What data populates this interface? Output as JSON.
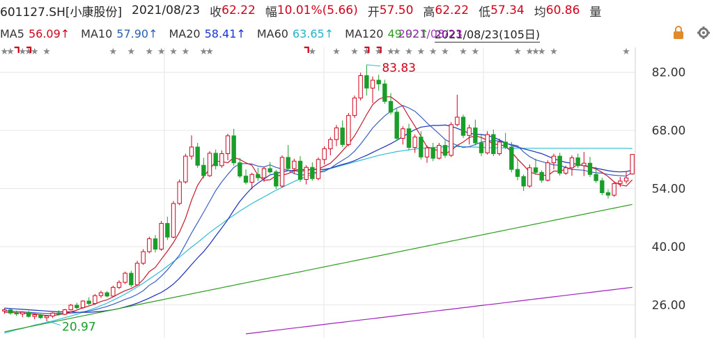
{
  "header": {
    "stock": "601127.SH[小康股份]",
    "date": "2021/08/23",
    "close_label": "收",
    "close": "62.22",
    "change_label": "幅",
    "change": "10.01%(5.66)",
    "open_label": "开",
    "open": "57.50",
    "high_label": "高",
    "high": "62.22",
    "low_label": "低",
    "low": "57.34",
    "avg_label": "均",
    "avg": "60.86",
    "vol_label": "量"
  },
  "ma_bar": {
    "items": [
      {
        "label": "MA5",
        "value": "56.09↑",
        "color": "#d0021b"
      },
      {
        "label": "MA10",
        "value": "57.90↑",
        "color": "#2a5fb0"
      },
      {
        "label": "MA20",
        "value": "58.41↑",
        "color": "#1a33d6"
      },
      {
        "label": "MA60",
        "value": "63.65↑",
        "color": "#22b3cc"
      },
      {
        "label": "MA120",
        "value": "49.92↑",
        "color": "#2e9e1f"
      }
    ],
    "overlap_text": "2021/08/23",
    "overlap_color": "#a020c0",
    "range_text": "2021/08/23(105日)"
  },
  "colors": {
    "up": "#d0021b",
    "down": "#1a9e2a",
    "ma5": "#c2182b",
    "ma10": "#3b5fc0",
    "ma20": "#1a2eb8",
    "ma60": "#2fbcd6",
    "ma120": "#2e9e1f",
    "ma250": "#a020c0",
    "grid": "#e6e6e6",
    "axis_text": "#333333"
  },
  "icons": [
    "lock-icon",
    "gear-icon"
  ],
  "chart_data": {
    "type": "candlestick",
    "ylim": [
      18,
      88
    ],
    "yticks": [
      "82.00",
      "68.00",
      "54.00",
      "40.00",
      "26.00"
    ],
    "annotations": [
      {
        "text": "83.83",
        "type": "max",
        "color": "#d0021b"
      },
      {
        "text": "20.97",
        "type": "min",
        "color": "#1a9e2a"
      }
    ],
    "candles": [
      [
        24.5,
        25.2,
        23.8,
        24.8
      ],
      [
        24.8,
        25.0,
        23.6,
        24.0
      ],
      [
        24.0,
        24.6,
        23.3,
        23.8
      ],
      [
        23.8,
        24.4,
        23.0,
        24.2
      ],
      [
        24.2,
        24.5,
        22.9,
        23.2
      ],
      [
        23.2,
        23.9,
        22.5,
        23.6
      ],
      [
        23.6,
        23.8,
        22.6,
        22.9
      ],
      [
        22.9,
        23.5,
        22.1,
        23.3
      ],
      [
        23.3,
        24.2,
        22.8,
        24.0
      ],
      [
        24.0,
        24.7,
        23.4,
        23.7
      ],
      [
        23.7,
        25.0,
        23.5,
        24.8
      ],
      [
        24.8,
        26.2,
        24.6,
        25.9
      ],
      [
        25.9,
        26.5,
        24.9,
        25.3
      ],
      [
        25.3,
        27.1,
        25.0,
        26.9
      ],
      [
        26.9,
        27.8,
        25.9,
        26.3
      ],
      [
        26.3,
        28.6,
        26.0,
        28.2
      ],
      [
        28.2,
        29.4,
        27.6,
        28.9
      ],
      [
        28.9,
        29.3,
        27.8,
        28.1
      ],
      [
        28.1,
        30.6,
        27.9,
        30.2
      ],
      [
        30.2,
        31.9,
        29.8,
        31.4
      ],
      [
        31.4,
        34.0,
        31.0,
        33.6
      ],
      [
        33.6,
        34.2,
        30.2,
        30.8
      ],
      [
        30.8,
        36.6,
        30.6,
        36.0
      ],
      [
        36.0,
        39.4,
        35.6,
        38.8
      ],
      [
        38.8,
        42.4,
        38.4,
        41.9
      ],
      [
        41.9,
        42.8,
        38.6,
        39.4
      ],
      [
        39.4,
        46.2,
        39.0,
        45.6
      ],
      [
        45.6,
        47.2,
        41.6,
        42.3
      ],
      [
        42.3,
        51.0,
        42.0,
        50.4
      ],
      [
        50.4,
        56.2,
        50.0,
        55.6
      ],
      [
        55.6,
        62.4,
        55.2,
        61.8
      ],
      [
        61.8,
        66.8,
        61.0,
        64.0
      ],
      [
        64.0,
        65.0,
        59.0,
        59.6
      ],
      [
        59.6,
        61.4,
        56.4,
        57.1
      ],
      [
        57.1,
        63.0,
        56.8,
        62.5
      ],
      [
        62.5,
        63.4,
        58.6,
        59.5
      ],
      [
        59.5,
        63.2,
        59.0,
        62.4
      ],
      [
        62.4,
        67.2,
        60.8,
        66.7
      ],
      [
        66.7,
        68.4,
        59.5,
        60.2
      ],
      [
        60.2,
        61.4,
        56.5,
        57.0
      ],
      [
        57.0,
        58.6,
        55.0,
        55.5
      ],
      [
        55.5,
        57.8,
        53.8,
        57.4
      ],
      [
        57.4,
        59.0,
        55.8,
        56.6
      ],
      [
        56.6,
        59.3,
        55.6,
        58.8
      ],
      [
        58.8,
        60.4,
        57.6,
        58.0
      ],
      [
        58.0,
        58.5,
        53.9,
        54.6
      ],
      [
        54.6,
        62.0,
        54.2,
        61.5
      ],
      [
        61.5,
        64.5,
        58.2,
        58.8
      ],
      [
        58.8,
        61.2,
        57.5,
        60.6
      ],
      [
        60.6,
        61.8,
        55.6,
        56.2
      ],
      [
        56.2,
        59.6,
        55.0,
        59.1
      ],
      [
        59.1,
        60.3,
        55.9,
        56.4
      ],
      [
        56.4,
        61.5,
        56.0,
        61.0
      ],
      [
        61.0,
        64.2,
        59.8,
        63.6
      ],
      [
        63.6,
        66.4,
        62.0,
        65.8
      ],
      [
        65.8,
        69.3,
        64.2,
        68.6
      ],
      [
        68.6,
        70.4,
        64.0,
        64.6
      ],
      [
        64.6,
        72.2,
        64.2,
        71.6
      ],
      [
        71.6,
        76.4,
        71.0,
        75.8
      ],
      [
        75.8,
        81.9,
        75.2,
        81.2
      ],
      [
        81.2,
        83.83,
        76.4,
        78.2
      ],
      [
        78.2,
        81.0,
        74.6,
        80.1
      ],
      [
        80.1,
        81.4,
        77.6,
        79.2
      ],
      [
        79.2,
        80.2,
        74.4,
        75.0
      ],
      [
        75.0,
        77.0,
        71.8,
        72.4
      ],
      [
        72.4,
        73.2,
        65.5,
        66.1
      ],
      [
        66.1,
        69.0,
        64.6,
        68.4
      ],
      [
        68.4,
        69.6,
        63.2,
        63.9
      ],
      [
        63.9,
        67.0,
        62.6,
        66.4
      ],
      [
        66.4,
        67.8,
        61.0,
        61.6
      ],
      [
        61.6,
        64.4,
        60.2,
        63.8
      ],
      [
        63.8,
        65.0,
        60.6,
        61.3
      ],
      [
        61.3,
        65.0,
        61.0,
        64.4
      ],
      [
        64.4,
        65.6,
        61.4,
        62.0
      ],
      [
        62.0,
        70.0,
        61.6,
        69.4
      ],
      [
        69.4,
        76.6,
        69.0,
        71.2
      ],
      [
        71.2,
        71.8,
        66.2,
        66.8
      ],
      [
        66.8,
        69.4,
        64.6,
        68.6
      ],
      [
        68.6,
        70.6,
        64.4,
        65.0
      ],
      [
        65.0,
        67.2,
        61.8,
        62.6
      ],
      [
        62.6,
        67.8,
        62.2,
        67.0
      ],
      [
        67.0,
        68.2,
        61.8,
        62.4
      ],
      [
        62.4,
        66.0,
        61.9,
        65.2
      ],
      [
        65.2,
        67.4,
        63.5,
        64.0
      ],
      [
        64.0,
        65.2,
        57.9,
        58.6
      ],
      [
        58.6,
        61.2,
        56.0,
        56.9
      ],
      [
        56.9,
        57.4,
        53.4,
        54.6
      ],
      [
        54.6,
        59.8,
        54.2,
        59.0
      ],
      [
        59.0,
        61.2,
        57.3,
        57.9
      ],
      [
        57.9,
        58.4,
        55.4,
        56.0
      ],
      [
        56.0,
        60.8,
        55.7,
        60.2
      ],
      [
        60.2,
        62.4,
        58.6,
        61.8
      ],
      [
        61.8,
        62.6,
        57.1,
        57.7
      ],
      [
        57.7,
        59.5,
        57.3,
        59.0
      ],
      [
        59.0,
        62.0,
        57.1,
        61.4
      ],
      [
        61.4,
        62.4,
        58.9,
        59.5
      ],
      [
        59.5,
        62.8,
        57.0,
        60.1
      ],
      [
        60.1,
        61.6,
        56.8,
        57.4
      ],
      [
        57.4,
        59.2,
        55.4,
        55.9
      ],
      [
        55.9,
        56.6,
        52.4,
        53.0
      ],
      [
        53.0,
        53.8,
        51.6,
        52.4
      ],
      [
        52.4,
        55.6,
        52.0,
        55.2
      ],
      [
        55.2,
        56.8,
        54.4,
        55.8
      ],
      [
        55.8,
        58.0,
        55.2,
        56.56
      ],
      [
        57.5,
        62.22,
        57.34,
        62.22
      ]
    ],
    "ma5": [
      24.2,
      24.2,
      24.1,
      24.0,
      23.9,
      23.8,
      23.6,
      23.4,
      23.4,
      23.6,
      23.9,
      24.3,
      24.7,
      25.3,
      25.7,
      26.2,
      26.8,
      27.2,
      27.9,
      28.7,
      29.4,
      29.9,
      30.7,
      32.1,
      34.0,
      35.0,
      37.0,
      38.9,
      41.0,
      43.5,
      46.8,
      51.2,
      54.8,
      57.0,
      58.6,
      60.6,
      60.5,
      60.2,
      61.5,
      61.0,
      60.2,
      59.6,
      57.2,
      56.0,
      56.1,
      57.1,
      57.2,
      57.6,
      58.3,
      58.1,
      58.4,
      58.6,
      58.7,
      59.4,
      60.1,
      61.5,
      63.1,
      64.7,
      66.7,
      69.2,
      71.8,
      74.2,
      75.5,
      76.1,
      76.1,
      75.0,
      73.8,
      71.3,
      69.0,
      66.6,
      64.0,
      63.6,
      63.0,
      62.3,
      63.2,
      64.4,
      65.2,
      66.3,
      66.7,
      66.3,
      65.6,
      64.7,
      64.6,
      64.2,
      62.8,
      61.1,
      59.6,
      58.0,
      57.5,
      57.3,
      57.1,
      58.2,
      58.2,
      58.6,
      59.1,
      59.7,
      59.6,
      59.2,
      58.7,
      57.9,
      56.9,
      55.6,
      54.9,
      54.6,
      56.09
    ],
    "ma10": [
      24.6,
      24.5,
      24.4,
      24.3,
      24.2,
      24.1,
      24.0,
      23.9,
      23.9,
      23.9,
      23.9,
      24.0,
      24.1,
      24.3,
      24.5,
      24.8,
      25.2,
      25.6,
      26.1,
      26.7,
      27.3,
      27.8,
      28.5,
      29.4,
      30.7,
      31.6,
      32.9,
      34.4,
      36.2,
      38.0,
      40.6,
      43.3,
      45.8,
      48.3,
      50.9,
      53.5,
      55.6,
      57.4,
      59.1,
      60.0,
      60.0,
      59.9,
      59.4,
      59.2,
      59.7,
      59.1,
      58.7,
      58.4,
      57.6,
      57.2,
      57.4,
      57.9,
      57.9,
      58.1,
      58.9,
      59.9,
      60.8,
      61.7,
      63.0,
      64.7,
      66.6,
      68.6,
      70.1,
      71.5,
      72.6,
      73.4,
      74.0,
      73.4,
      72.6,
      71.3,
      69.8,
      68.5,
      67.2,
      65.8,
      65.0,
      64.4,
      63.9,
      64.1,
      64.6,
      65.2,
      65.4,
      65.6,
      65.4,
      64.9,
      64.6,
      64.3,
      62.8,
      61.7,
      60.9,
      60.5,
      60.1,
      59.7,
      59.6,
      59.1,
      58.6,
      58.5,
      58.4,
      58.0,
      57.8,
      57.7,
      57.4,
      57.2,
      57.1,
      57.0,
      57.9
    ],
    "ma20": [
      25.2,
      25.1,
      25.0,
      24.9,
      24.8,
      24.7,
      24.6,
      24.5,
      24.4,
      24.3,
      24.3,
      24.3,
      24.2,
      24.2,
      24.2,
      24.3,
      24.4,
      24.6,
      24.8,
      25.1,
      25.5,
      25.9,
      26.4,
      27.0,
      27.6,
      28.3,
      29.0,
      29.9,
      31.0,
      32.4,
      34.0,
      35.7,
      37.3,
      38.8,
      40.6,
      42.6,
      44.5,
      46.5,
      48.8,
      50.9,
      52.6,
      54.2,
      55.3,
      56.3,
      57.3,
      57.6,
      58.0,
      58.3,
      58.4,
      58.6,
      58.5,
      58.6,
      58.6,
      58.6,
      58.9,
      59.4,
      59.8,
      60.2,
      60.7,
      61.4,
      62.0,
      62.7,
      63.4,
      64.1,
      64.8,
      65.6,
      66.5,
      67.4,
      68.2,
      68.8,
      69.0,
      69.2,
      69.2,
      69.3,
      69.0,
      68.5,
      67.9,
      67.3,
      67.1,
      67.0,
      66.8,
      66.4,
      65.7,
      65.0,
      64.4,
      64.0,
      63.6,
      63.2,
      62.8,
      62.4,
      61.8,
      61.2,
      60.7,
      60.3,
      60.1,
      59.8,
      59.5,
      59.2,
      58.9,
      58.6,
      58.3,
      58.1,
      58.0,
      58.1,
      58.41
    ],
    "ma60": [
      19.2,
      19.6,
      20.0,
      20.3,
      20.7,
      21.1,
      21.4,
      21.8,
      22.1,
      22.5,
      22.9,
      23.3,
      23.7,
      24.2,
      24.7,
      25.2,
      25.8,
      26.4,
      27.1,
      27.8,
      28.6,
      29.4,
      30.3,
      31.2,
      32.2,
      33.2,
      34.2,
      35.3,
      36.4,
      37.5,
      38.7,
      39.9,
      41.0,
      42.2,
      43.4,
      44.5,
      45.5,
      46.6,
      47.6,
      48.6,
      49.5,
      50.4,
      51.2,
      52.0,
      52.8,
      53.6,
      54.3,
      55.0,
      55.7,
      56.3,
      56.9,
      57.4,
      57.9,
      58.4,
      58.8,
      59.2,
      59.6,
      60.0,
      60.4,
      60.8,
      61.2,
      61.6,
      62.0,
      62.3,
      62.6,
      62.9,
      63.1,
      63.3,
      63.5,
      63.7,
      63.8,
      63.9,
      64.0,
      64.1,
      64.1,
      64.1,
      64.1,
      64.0,
      64.0,
      63.9,
      63.9,
      63.8,
      63.8,
      63.8,
      63.7,
      63.7,
      63.7,
      63.7,
      63.7,
      63.7,
      63.7,
      63.7,
      63.7,
      63.7,
      63.7,
      63.7,
      63.7,
      63.7,
      63.7,
      63.7,
      63.7,
      63.7,
      63.7,
      63.7,
      63.65
    ]
  }
}
